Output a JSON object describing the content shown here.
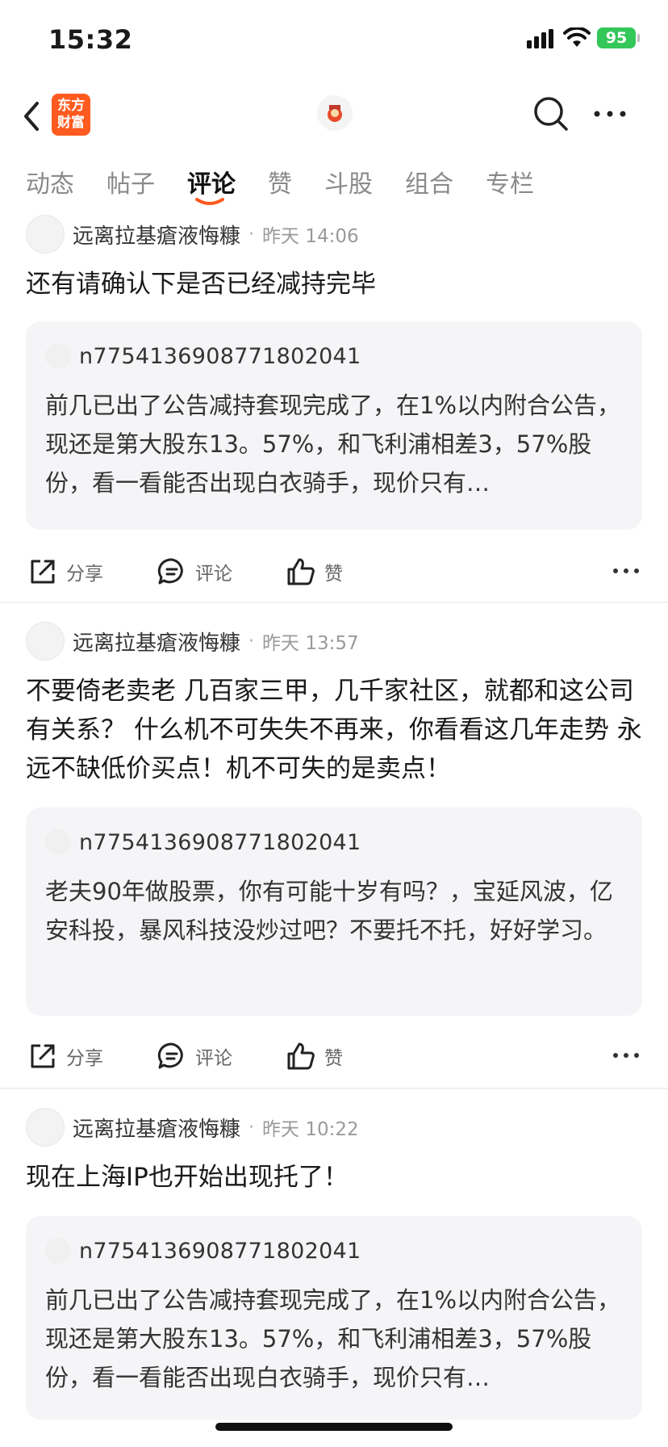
{
  "status": {
    "time": "15:32",
    "battery": "95"
  },
  "header": {
    "logo_line1": "东方",
    "logo_line2": "财富"
  },
  "tabs": [
    {
      "label": "动态",
      "active": false
    },
    {
      "label": "帖子",
      "active": false
    },
    {
      "label": "评论",
      "active": true
    },
    {
      "label": "赞",
      "active": false
    },
    {
      "label": "斗股",
      "active": false
    },
    {
      "label": "组合",
      "active": false
    },
    {
      "label": "专栏",
      "active": false
    }
  ],
  "posts": [
    {
      "author": "远离拉基瘡液悔糠",
      "time": "昨天 14:06",
      "content": "还有请确认下是否已经减持完毕",
      "quote_user": "n7754136908771802041",
      "quote_text": "前几已出了公告减持套现完成了，在1%以内附合公告，现还是第大股东13。57%，和飞利浦相差3，57%股份，看一看能否出现白衣骑手，现价只有…"
    },
    {
      "author": "远离拉基瘡液悔糠",
      "time": "昨天 13:57",
      "content": "不要倚老卖老 几百家三甲，几千家社区，就都和这公司有关系？ 什么机不可失失不再来，你看看这几年走势 永远不缺低价买点！机不可失的是卖点！",
      "quote_user": "n7754136908771802041",
      "quote_text": "老夫90年做股票，你有可能十岁有吗？，宝延风波，亿安科投，暴风科技没炒过吧？不要托不托，好好学习。"
    },
    {
      "author": "远离拉基瘡液悔糠",
      "time": "昨天 10:22",
      "content": "现在上海IP也开始出现托了！",
      "quote_user": "n7754136908771802041",
      "quote_text": "前几已出了公告减持套现完成了，在1%以内附合公告，现还是第大股东13。57%，和飞利浦相差3，57%股份，看一看能否出现白衣骑手，现价只有…"
    }
  ],
  "actions": {
    "share": "分享",
    "comment": "评论",
    "like": "赞"
  },
  "colors": {
    "brand": "#ff5a1f",
    "battery": "#34c759",
    "quote_bg": "#f5f5f7"
  }
}
